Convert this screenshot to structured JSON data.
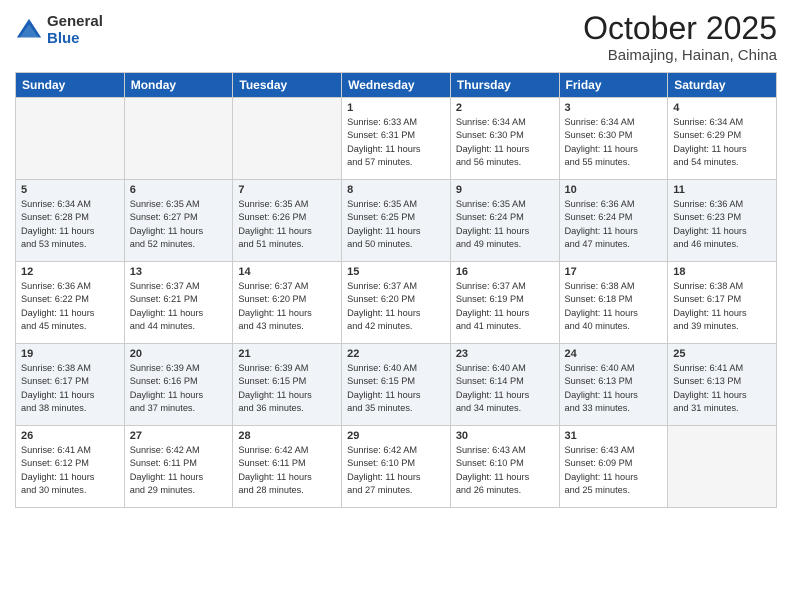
{
  "header": {
    "logo": {
      "general": "General",
      "blue": "Blue"
    },
    "title": "October 2025",
    "location": "Baimajing, Hainan, China"
  },
  "days_of_week": [
    "Sunday",
    "Monday",
    "Tuesday",
    "Wednesday",
    "Thursday",
    "Friday",
    "Saturday"
  ],
  "weeks": [
    [
      {
        "day": "",
        "info": ""
      },
      {
        "day": "",
        "info": ""
      },
      {
        "day": "",
        "info": ""
      },
      {
        "day": "1",
        "info": "Sunrise: 6:33 AM\nSunset: 6:31 PM\nDaylight: 11 hours\nand 57 minutes."
      },
      {
        "day": "2",
        "info": "Sunrise: 6:34 AM\nSunset: 6:30 PM\nDaylight: 11 hours\nand 56 minutes."
      },
      {
        "day": "3",
        "info": "Sunrise: 6:34 AM\nSunset: 6:30 PM\nDaylight: 11 hours\nand 55 minutes."
      },
      {
        "day": "4",
        "info": "Sunrise: 6:34 AM\nSunset: 6:29 PM\nDaylight: 11 hours\nand 54 minutes."
      }
    ],
    [
      {
        "day": "5",
        "info": "Sunrise: 6:34 AM\nSunset: 6:28 PM\nDaylight: 11 hours\nand 53 minutes."
      },
      {
        "day": "6",
        "info": "Sunrise: 6:35 AM\nSunset: 6:27 PM\nDaylight: 11 hours\nand 52 minutes."
      },
      {
        "day": "7",
        "info": "Sunrise: 6:35 AM\nSunset: 6:26 PM\nDaylight: 11 hours\nand 51 minutes."
      },
      {
        "day": "8",
        "info": "Sunrise: 6:35 AM\nSunset: 6:25 PM\nDaylight: 11 hours\nand 50 minutes."
      },
      {
        "day": "9",
        "info": "Sunrise: 6:35 AM\nSunset: 6:24 PM\nDaylight: 11 hours\nand 49 minutes."
      },
      {
        "day": "10",
        "info": "Sunrise: 6:36 AM\nSunset: 6:24 PM\nDaylight: 11 hours\nand 47 minutes."
      },
      {
        "day": "11",
        "info": "Sunrise: 6:36 AM\nSunset: 6:23 PM\nDaylight: 11 hours\nand 46 minutes."
      }
    ],
    [
      {
        "day": "12",
        "info": "Sunrise: 6:36 AM\nSunset: 6:22 PM\nDaylight: 11 hours\nand 45 minutes."
      },
      {
        "day": "13",
        "info": "Sunrise: 6:37 AM\nSunset: 6:21 PM\nDaylight: 11 hours\nand 44 minutes."
      },
      {
        "day": "14",
        "info": "Sunrise: 6:37 AM\nSunset: 6:20 PM\nDaylight: 11 hours\nand 43 minutes."
      },
      {
        "day": "15",
        "info": "Sunrise: 6:37 AM\nSunset: 6:20 PM\nDaylight: 11 hours\nand 42 minutes."
      },
      {
        "day": "16",
        "info": "Sunrise: 6:37 AM\nSunset: 6:19 PM\nDaylight: 11 hours\nand 41 minutes."
      },
      {
        "day": "17",
        "info": "Sunrise: 6:38 AM\nSunset: 6:18 PM\nDaylight: 11 hours\nand 40 minutes."
      },
      {
        "day": "18",
        "info": "Sunrise: 6:38 AM\nSunset: 6:17 PM\nDaylight: 11 hours\nand 39 minutes."
      }
    ],
    [
      {
        "day": "19",
        "info": "Sunrise: 6:38 AM\nSunset: 6:17 PM\nDaylight: 11 hours\nand 38 minutes."
      },
      {
        "day": "20",
        "info": "Sunrise: 6:39 AM\nSunset: 6:16 PM\nDaylight: 11 hours\nand 37 minutes."
      },
      {
        "day": "21",
        "info": "Sunrise: 6:39 AM\nSunset: 6:15 PM\nDaylight: 11 hours\nand 36 minutes."
      },
      {
        "day": "22",
        "info": "Sunrise: 6:40 AM\nSunset: 6:15 PM\nDaylight: 11 hours\nand 35 minutes."
      },
      {
        "day": "23",
        "info": "Sunrise: 6:40 AM\nSunset: 6:14 PM\nDaylight: 11 hours\nand 34 minutes."
      },
      {
        "day": "24",
        "info": "Sunrise: 6:40 AM\nSunset: 6:13 PM\nDaylight: 11 hours\nand 33 minutes."
      },
      {
        "day": "25",
        "info": "Sunrise: 6:41 AM\nSunset: 6:13 PM\nDaylight: 11 hours\nand 31 minutes."
      }
    ],
    [
      {
        "day": "26",
        "info": "Sunrise: 6:41 AM\nSunset: 6:12 PM\nDaylight: 11 hours\nand 30 minutes."
      },
      {
        "day": "27",
        "info": "Sunrise: 6:42 AM\nSunset: 6:11 PM\nDaylight: 11 hours\nand 29 minutes."
      },
      {
        "day": "28",
        "info": "Sunrise: 6:42 AM\nSunset: 6:11 PM\nDaylight: 11 hours\nand 28 minutes."
      },
      {
        "day": "29",
        "info": "Sunrise: 6:42 AM\nSunset: 6:10 PM\nDaylight: 11 hours\nand 27 minutes."
      },
      {
        "day": "30",
        "info": "Sunrise: 6:43 AM\nSunset: 6:10 PM\nDaylight: 11 hours\nand 26 minutes."
      },
      {
        "day": "31",
        "info": "Sunrise: 6:43 AM\nSunset: 6:09 PM\nDaylight: 11 hours\nand 25 minutes."
      },
      {
        "day": "",
        "info": ""
      }
    ]
  ]
}
